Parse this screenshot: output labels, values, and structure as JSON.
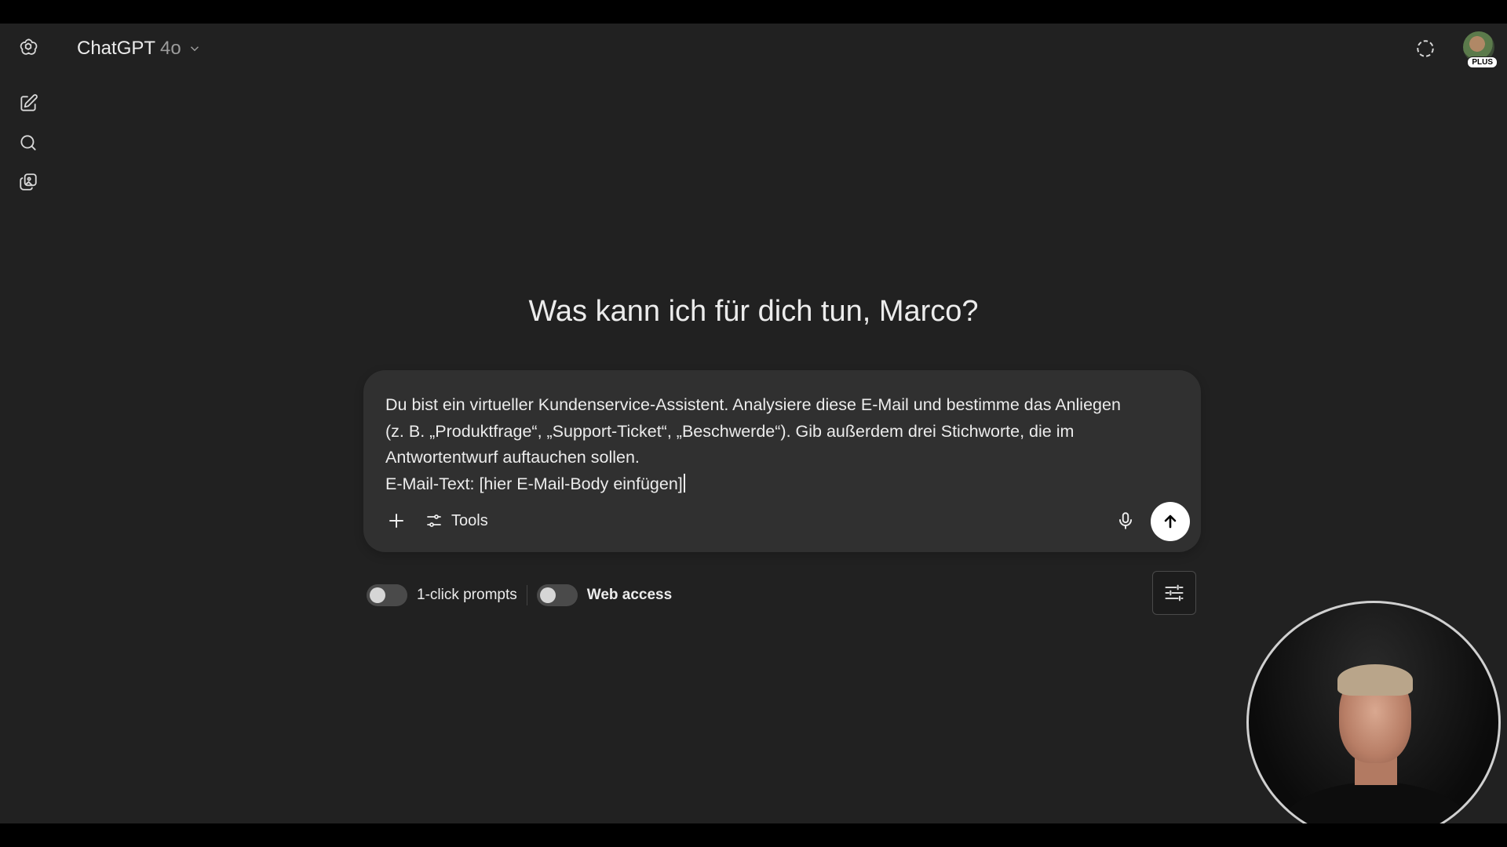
{
  "header": {
    "model_name": "ChatGPT",
    "model_version": "4o",
    "plan_badge": "PLUS"
  },
  "icons": {
    "logo": "openai-logo-icon",
    "new_chat": "new-chat-icon",
    "search": "search-icon",
    "library": "library-icon",
    "temporary_chat": "temporary-chat-icon"
  },
  "main": {
    "greeting": "Was kann ich für dich tun, Marco?"
  },
  "composer": {
    "text": "Du bist ein virtueller Kundenservice-Assistent. Analysiere diese E-Mail und bestimme das Anliegen\n(z. B. „Produktfrage“, „Support-Ticket“, „Beschwerde“). Gib außerdem drei Stichworte, die im\nAntwortentwurf auftauchen sollen.\nE-Mail-Text: [hier E-Mail-Body einfügen]",
    "tools_label": "Tools"
  },
  "options": {
    "one_click_label": "1-click prompts",
    "one_click_on": false,
    "web_access_label": "Web access",
    "web_access_on": false
  },
  "colors": {
    "background": "#212121",
    "composer": "#303030",
    "text": "#ececec",
    "send_button": "#ffffff"
  }
}
